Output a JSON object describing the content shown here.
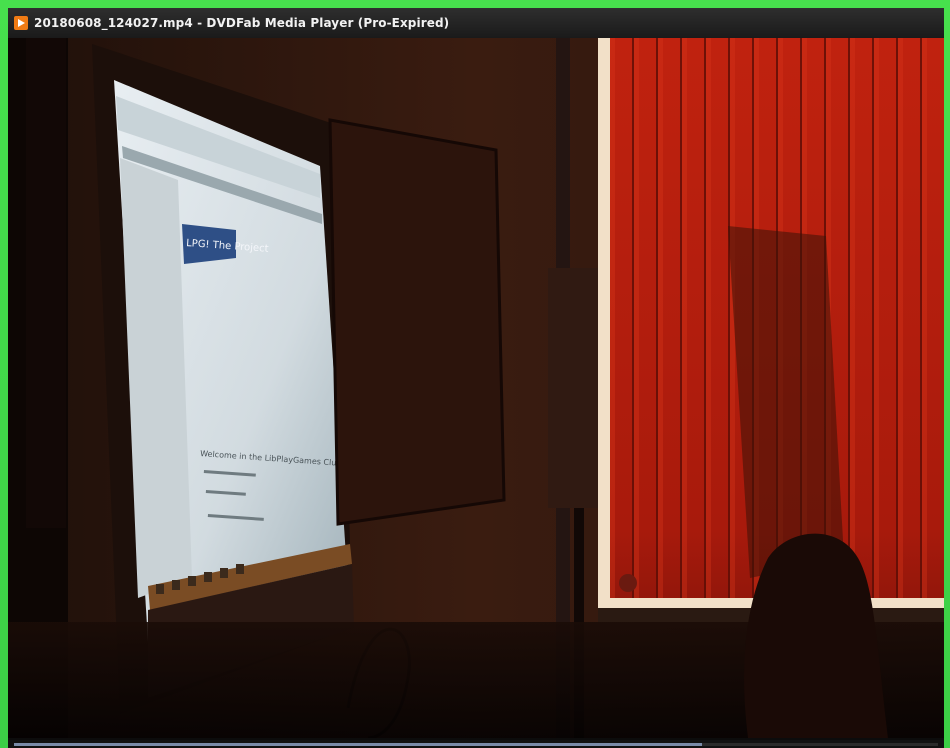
{
  "window": {
    "title": "20180608_124027.mp4 - DVDFab Media Player (Pro-Expired)",
    "app_icon": "dvdfab-play-icon"
  },
  "player": {
    "playback_progress": 0.745
  },
  "scene": {
    "projected_screen": {
      "heading": "LPG! The Project",
      "subheading": "Welcome in the LibPlayGames Club"
    }
  },
  "colors": {
    "frame_green": "#3fd24a",
    "curtain_red": "#b8200f",
    "titlebar": "#1a1a1a",
    "projector_blue": "#2e4f86"
  }
}
